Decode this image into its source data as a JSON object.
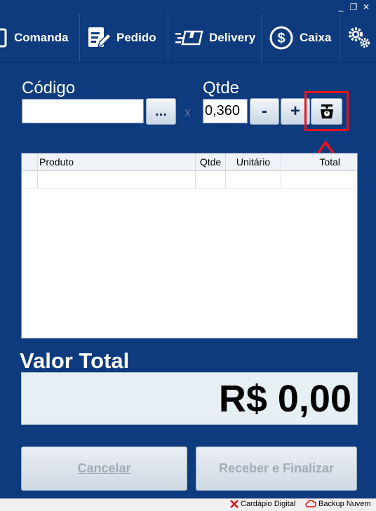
{
  "window": {
    "minimize": "_",
    "restore": "❐",
    "close": "✕"
  },
  "toolbar": {
    "comanda": "Comanda",
    "pedido": "Pedido",
    "delivery": "Delivery",
    "caixa": "Caixa"
  },
  "form": {
    "codigo_label": "Código",
    "codigo_value": "",
    "browse_label": "...",
    "x_label": "x",
    "qtde_label": "Qtde",
    "qtde_value": "0,360",
    "minus_label": "-",
    "plus_label": "+"
  },
  "table": {
    "columns": [
      "Produto",
      "Qtde",
      "Unitário",
      "Total"
    ],
    "rows": []
  },
  "total": {
    "label": "Valor Total",
    "value": "R$ 0,00"
  },
  "actions": {
    "cancel": "Cancelar",
    "finish": "Receber e Finalizar"
  },
  "status": {
    "cardapio": "Cardápio Digital",
    "backup": "Backup Nuvem"
  },
  "icons": {
    "scale": "scale-icon",
    "highlight_color": "#e8141c"
  }
}
